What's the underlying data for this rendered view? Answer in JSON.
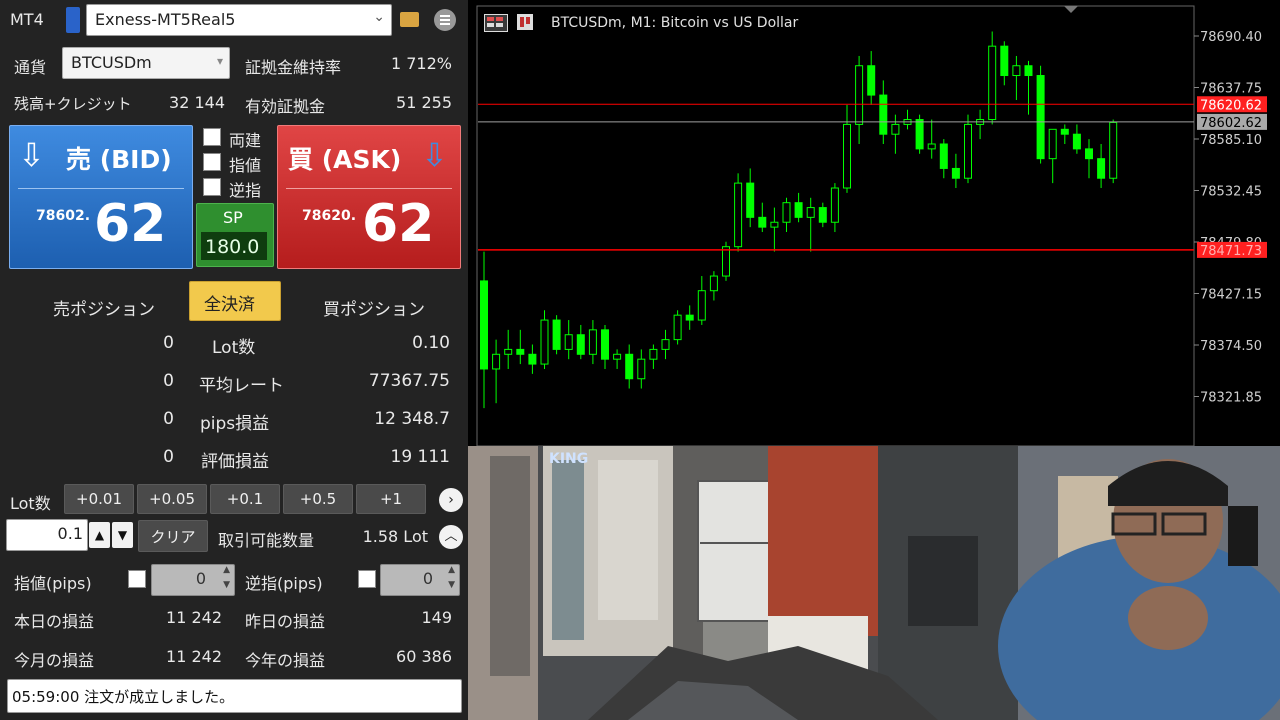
{
  "panel": {
    "mt4": "MT4",
    "account": "Exness-MT5Real5",
    "currency_label": "通貨",
    "currency_value": "BTCUSDm",
    "margin_rate_label": "証拠金維持率",
    "margin_rate_value": "1 712%",
    "balance_label": "残高+クレジット",
    "balance_value": "32 144",
    "equity_label": "有効証拠金",
    "equity_value": "51 255",
    "sell_title": "売 (BID)",
    "sell_small": "78602.",
    "sell_big": "62",
    "buy_title": "買 (ASK)",
    "buy_small": "78620.",
    "buy_big": "62",
    "opt1": "両建",
    "opt2": "指値",
    "opt3": "逆指",
    "sp_label": "SP",
    "sp_value": "180.0",
    "sell_positions": "売ポジション",
    "close_all": "全決済",
    "buy_positions": "買ポジション",
    "rows": [
      {
        "left": "0",
        "label": "Lot数",
        "right": "0.10"
      },
      {
        "left": "0",
        "label": "平均レート",
        "right": "77367.75"
      },
      {
        "left": "0",
        "label": "pips損益",
        "right": "12 348.7"
      },
      {
        "left": "0",
        "label": "評価損益",
        "right": "19 111"
      }
    ],
    "lot_label": "Lot数",
    "lot_buttons": [
      "+0.01",
      "+0.05",
      "+0.1",
      "+0.5",
      "+1"
    ],
    "lot_value": "0.1",
    "clear": "クリア",
    "tradable_label": "取引可能数量",
    "tradable_value": "1.58 Lot",
    "limit_label": "指値(pips)",
    "limit_value": "0",
    "stop_label": "逆指(pips)",
    "stop_value": "0",
    "today_label": "本日の損益",
    "today_value": "11 242",
    "yesterday_label": "昨日の損益",
    "yesterday_value": "149",
    "month_label": "今月の損益",
    "month_value": "11 242",
    "year_label": "今年の損益",
    "year_value": "60 386",
    "status": "05:59:00 注文が成立しました。"
  },
  "chart": {
    "title": "BTCUSDm, M1:  Bitcoin vs US Dollar",
    "axis_labels": [
      "78690.40",
      "78637.75",
      "78585.10",
      "78532.45",
      "78479.80",
      "78427.15",
      "78374.50",
      "78321.85"
    ],
    "ask_line": "78620.62",
    "bid_line": "78602.62",
    "position_line": "78471.73",
    "candles": [
      [
        78440,
        78470,
        78310,
        78350
      ],
      [
        78350,
        78380,
        78315,
        78365
      ],
      [
        78365,
        78390,
        78350,
        78370
      ],
      [
        78370,
        78390,
        78355,
        78365
      ],
      [
        78365,
        78375,
        78345,
        78355
      ],
      [
        78355,
        78410,
        78350,
        78400
      ],
      [
        78400,
        78405,
        78365,
        78370
      ],
      [
        78370,
        78400,
        78360,
        78385
      ],
      [
        78385,
        78395,
        78360,
        78365
      ],
      [
        78365,
        78400,
        78355,
        78390
      ],
      [
        78390,
        78395,
        78350,
        78360
      ],
      [
        78360,
        78370,
        78350,
        78365
      ],
      [
        78365,
        78375,
        78330,
        78340
      ],
      [
        78340,
        78370,
        78330,
        78360
      ],
      [
        78360,
        78375,
        78350,
        78370
      ],
      [
        78370,
        78390,
        78360,
        78380
      ],
      [
        78380,
        78410,
        78375,
        78405
      ],
      [
        78405,
        78415,
        78390,
        78400
      ],
      [
        78400,
        78445,
        78395,
        78430
      ],
      [
        78430,
        78450,
        78420,
        78445
      ],
      [
        78445,
        78480,
        78440,
        78475
      ],
      [
        78475,
        78550,
        78470,
        78540
      ],
      [
        78540,
        78555,
        78495,
        78505
      ],
      [
        78505,
        78520,
        78490,
        78495
      ],
      [
        78495,
        78515,
        78470,
        78500
      ],
      [
        78500,
        78525,
        78490,
        78520
      ],
      [
        78520,
        78530,
        78500,
        78505
      ],
      [
        78505,
        78525,
        78470,
        78515
      ],
      [
        78515,
        78520,
        78495,
        78500
      ],
      [
        78500,
        78540,
        78490,
        78535
      ],
      [
        78535,
        78620,
        78530,
        78600
      ],
      [
        78600,
        78670,
        78580,
        78660
      ],
      [
        78660,
        78675,
        78620,
        78630
      ],
      [
        78630,
        78645,
        78580,
        78590
      ],
      [
        78590,
        78610,
        78570,
        78600
      ],
      [
        78600,
        78615,
        78595,
        78605
      ],
      [
        78605,
        78610,
        78570,
        78575
      ],
      [
        78575,
        78605,
        78565,
        78580
      ],
      [
        78580,
        78585,
        78545,
        78555
      ],
      [
        78555,
        78570,
        78535,
        78545
      ],
      [
        78545,
        78610,
        78540,
        78600
      ],
      [
        78600,
        78615,
        78585,
        78605
      ],
      [
        78605,
        78695,
        78600,
        78680
      ],
      [
        78680,
        78685,
        78640,
        78650
      ],
      [
        78650,
        78670,
        78625,
        78660
      ],
      [
        78660,
        78665,
        78610,
        78650
      ],
      [
        78650,
        78660,
        78560,
        78565
      ],
      [
        78565,
        78580,
        78540,
        78595
      ],
      [
        78595,
        78600,
        78580,
        78590
      ],
      [
        78590,
        78600,
        78570,
        78575
      ],
      [
        78575,
        78585,
        78545,
        78565
      ],
      [
        78565,
        78580,
        78535,
        78545
      ],
      [
        78545,
        78605,
        78540,
        78602
      ]
    ]
  },
  "scene": {
    "sign": "KING"
  },
  "colors": {
    "panel_bg": "#232323",
    "sell": "#2f78cf",
    "buy": "#d63232",
    "sp": "#2f8f2f",
    "close_all": "#f2c94c",
    "candle": "#00ff00",
    "ask_line": "#ff0000",
    "bid_line": "#a0a0a0"
  }
}
